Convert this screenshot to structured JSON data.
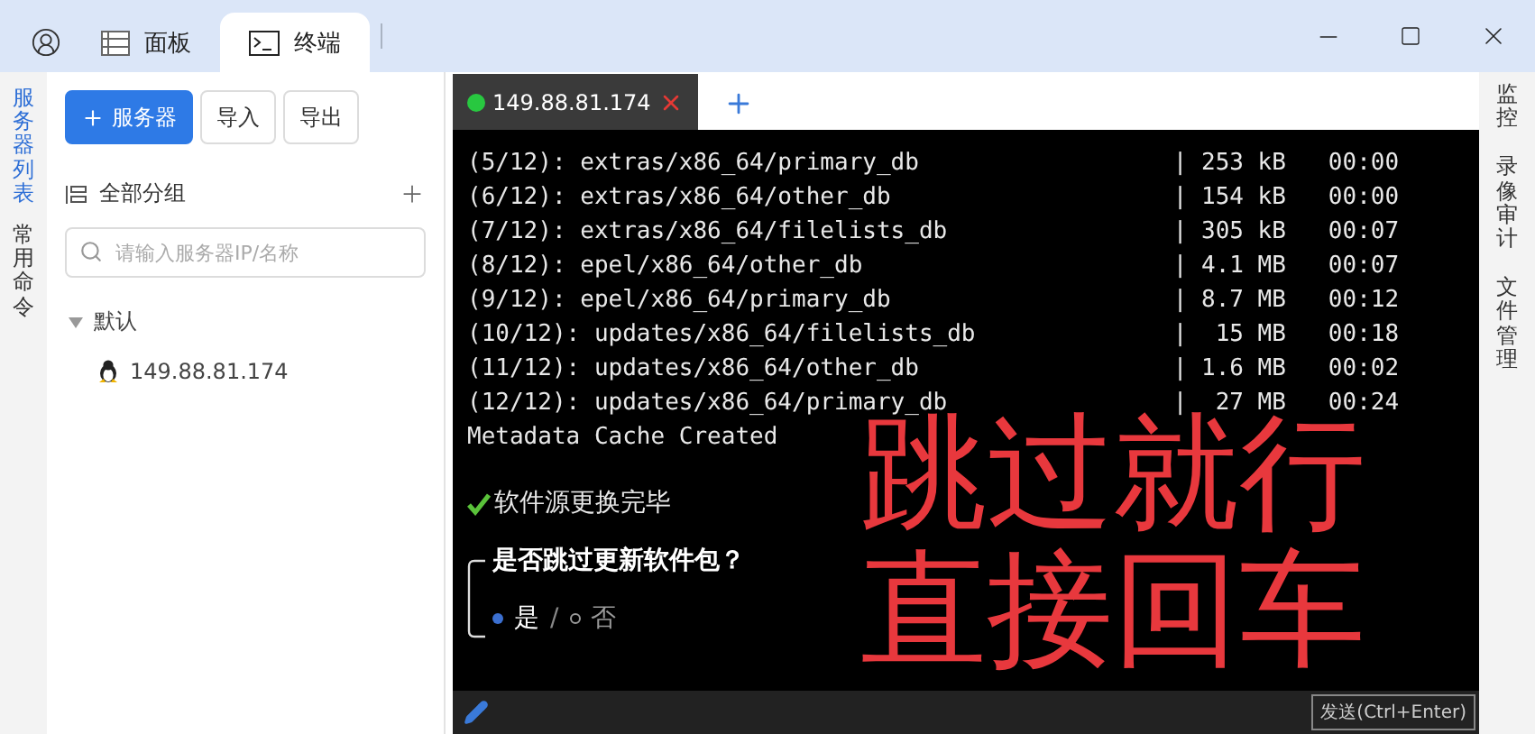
{
  "title_bar": {
    "tabs": [
      {
        "label": "面板",
        "kind": "panel",
        "selected": false
      },
      {
        "label": "终端",
        "kind": "terminal",
        "selected": true
      }
    ]
  },
  "left_rail": [
    {
      "label": "服务器列表",
      "selected": true
    },
    {
      "label": "常用命令",
      "selected": false
    }
  ],
  "sidebar": {
    "buttons": [
      {
        "label": "服务器",
        "kind": "primary"
      },
      {
        "label": "导入",
        "kind": "default"
      },
      {
        "label": "导出",
        "kind": "default"
      }
    ],
    "group_header": "全部分组",
    "search": {
      "placeholder": "请输入服务器IP/名称"
    },
    "tree": [
      {
        "label": "默认",
        "expanded": true,
        "children": [
          {
            "label": "149.88.81.174"
          }
        ]
      }
    ]
  },
  "terminal": {
    "tabs": [
      {
        "label": "149.88.81.174",
        "connected": true,
        "selected": true
      }
    ],
    "column_separator": "|",
    "rows": [
      {
        "text": "(5/12): extras/x86_64/primary_db",
        "size": "253 kB",
        "time": "00:00"
      },
      {
        "text": "(6/12): extras/x86_64/other_db",
        "size": "154 kB",
        "time": "00:00"
      },
      {
        "text": "(7/12): extras/x86_64/filelists_db",
        "size": "305 kB",
        "time": "00:07"
      },
      {
        "text": "(8/12): epel/x86_64/other_db",
        "size": "4.1 MB",
        "time": "00:07"
      },
      {
        "text": "(9/12): epel/x86_64/primary_db",
        "size": "8.7 MB",
        "time": "00:12"
      },
      {
        "text": "(10/12): updates/x86_64/filelists_db",
        "size": "15 MB",
        "time": "00:18"
      },
      {
        "text": "(11/12): updates/x86_64/other_db",
        "size": "1.6 MB",
        "time": "00:02"
      },
      {
        "text": "(12/12): updates/x86_64/primary_db",
        "size": "27 MB",
        "time": "00:24"
      }
    ],
    "status": "Metadata Cache Created",
    "done_message": "软件源更换完毕",
    "prompt": {
      "question": "是否跳过更新软件包？",
      "separator": "/",
      "options": [
        {
          "label": "是",
          "selected": true
        },
        {
          "label": "否",
          "selected": false
        }
      ]
    },
    "overlay": [
      "跳过就行",
      "直接回车"
    ],
    "send_button": "发送(Ctrl+Enter)"
  },
  "right_rail": [
    {
      "label": "监控"
    },
    {
      "label": "录像审计"
    },
    {
      "label": "文件管理"
    }
  ]
}
